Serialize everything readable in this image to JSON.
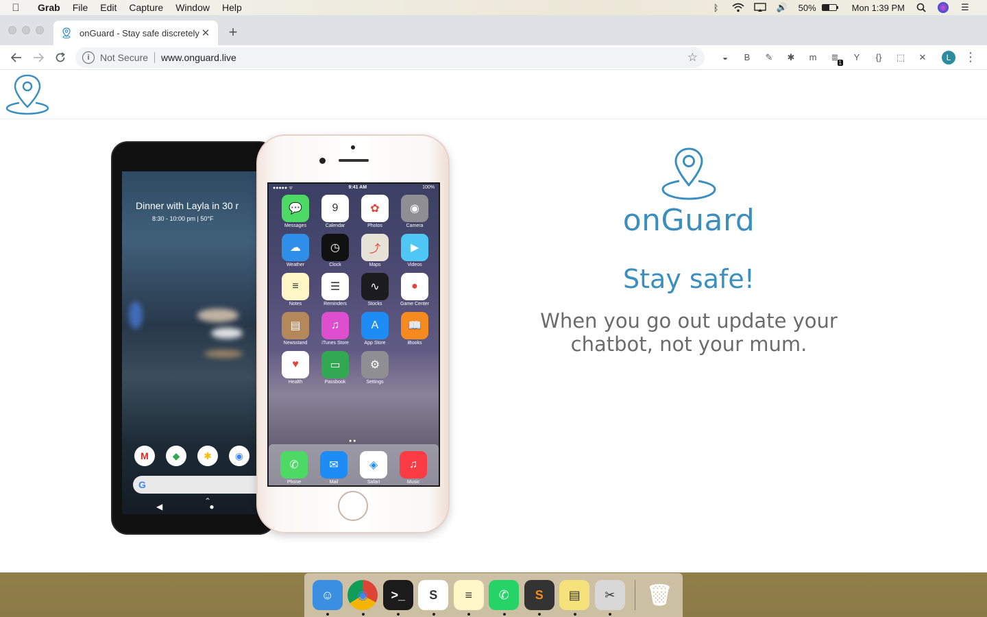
{
  "menubar": {
    "app_name": "Grab",
    "menus": [
      "File",
      "Edit",
      "Capture",
      "Window",
      "Help"
    ],
    "battery_percent": "50%",
    "battery_level": 0.5,
    "clock": "Mon 1:39 PM"
  },
  "browser": {
    "tab": {
      "title": "onGuard - Stay safe discretely",
      "close": "✕"
    },
    "new_tab": "+",
    "security_label": "Not Secure",
    "url": "www.onguard.live",
    "profile_initial": "L",
    "extensions": [
      {
        "name": "ext-circle-icon",
        "glyph": "◒"
      },
      {
        "name": "ext-b-icon",
        "glyph": "B"
      },
      {
        "name": "ext-eyedropper-icon",
        "glyph": "✎"
      },
      {
        "name": "ext-bug-icon",
        "glyph": "✱"
      },
      {
        "name": "ext-m-icon",
        "glyph": "m"
      },
      {
        "name": "ext-todoist-icon",
        "glyph": "≣",
        "badge": "1"
      },
      {
        "name": "ext-y-icon",
        "glyph": "Y"
      },
      {
        "name": "ext-braces-icon",
        "glyph": "{}"
      },
      {
        "name": "ext-screenshot-icon",
        "glyph": "⬚"
      },
      {
        "name": "ext-x-icon",
        "glyph": "✕"
      }
    ]
  },
  "hero": {
    "brand": "onGuard",
    "tagline": "Stay safe!",
    "subtitle": "When you go out update your chatbot, not your mum.",
    "accent_color": "#3a8fc0"
  },
  "pixel_phone": {
    "event_title": "Dinner with Layla in 30 r",
    "event_meta": "8:30 - 10:00 pm  |  50°F",
    "search_glyph": "G"
  },
  "iphone": {
    "status_left": "●●●●● ᯤ",
    "time": "9:41 AM",
    "battery": "100%",
    "apps": [
      {
        "label": "Messages",
        "color": "#4cd964",
        "glyph": "💬"
      },
      {
        "label": "Calendar",
        "color": "#ffffff",
        "glyph": "9"
      },
      {
        "label": "Photos",
        "color": "#ffffff",
        "glyph": "✿"
      },
      {
        "label": "Camera",
        "color": "#8e8e93",
        "glyph": "◉"
      },
      {
        "label": "Weather",
        "color": "#2f8ee8",
        "glyph": "☁"
      },
      {
        "label": "Clock",
        "color": "#111111",
        "glyph": "◷"
      },
      {
        "label": "Maps",
        "color": "#e6e2d6",
        "glyph": "⤴"
      },
      {
        "label": "Videos",
        "color": "#4ec7f5",
        "glyph": "▶"
      },
      {
        "label": "Notes",
        "color": "#fff6c6",
        "glyph": "≡"
      },
      {
        "label": "Reminders",
        "color": "#ffffff",
        "glyph": "☰"
      },
      {
        "label": "Stocks",
        "color": "#1c1c1e",
        "glyph": "∿"
      },
      {
        "label": "Game Center",
        "color": "#ffffff",
        "glyph": "●"
      },
      {
        "label": "Newsstand",
        "color": "#b5885c",
        "glyph": "▤"
      },
      {
        "label": "iTunes Store",
        "color": "#dd4fcf",
        "glyph": "♫"
      },
      {
        "label": "App Store",
        "color": "#1d8cf5",
        "glyph": "A"
      },
      {
        "label": "iBooks",
        "color": "#f58a1f",
        "glyph": "📖"
      },
      {
        "label": "Health",
        "color": "#ffffff",
        "glyph": "♥"
      },
      {
        "label": "Passbook",
        "color": "#32a852",
        "glyph": "▭"
      },
      {
        "label": "Settings",
        "color": "#8e8e93",
        "glyph": "⚙"
      }
    ],
    "dock_apps": [
      {
        "label": "Phone",
        "color": "#4cd964",
        "glyph": "✆"
      },
      {
        "label": "Mail",
        "color": "#1d8cf5",
        "glyph": "✉"
      },
      {
        "label": "Safari",
        "color": "#ffffff",
        "glyph": "◈"
      },
      {
        "label": "Music",
        "color": "#fc3c44",
        "glyph": "♫"
      }
    ]
  },
  "dock": {
    "apps": [
      {
        "name": "finder-icon",
        "color": "#3a8fe0",
        "glyph": "☺"
      },
      {
        "name": "chrome-icon",
        "color": "#ffffff",
        "glyph": "◉"
      },
      {
        "name": "terminal-icon",
        "color": "#1b1b1b",
        "glyph": ">_"
      },
      {
        "name": "slack-icon",
        "color": "#ffffff",
        "glyph": "S"
      },
      {
        "name": "notes-icon",
        "color": "#fff6c6",
        "glyph": "≡"
      },
      {
        "name": "whatsapp-icon",
        "color": "#25d366",
        "glyph": "✆"
      },
      {
        "name": "sublime-icon",
        "color": "#333333",
        "glyph": "S"
      },
      {
        "name": "stickies-icon",
        "color": "#f6e27a",
        "glyph": "▤"
      },
      {
        "name": "grab-icon",
        "color": "#d8d8d8",
        "glyph": "✂"
      }
    ],
    "trash_glyph": "🗑"
  }
}
